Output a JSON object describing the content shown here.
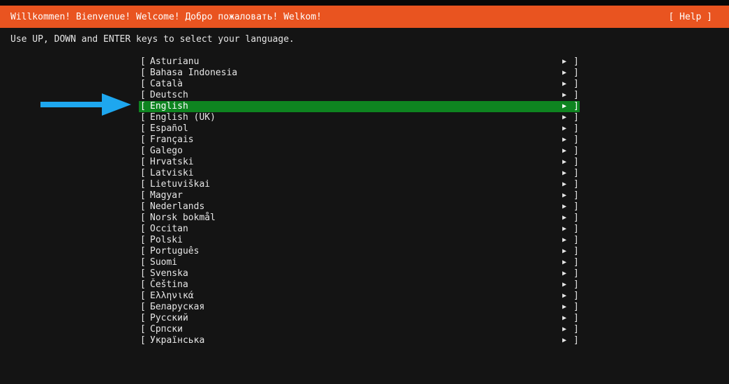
{
  "header": {
    "title": "Willkommen! Bienvenue! Welcome! Добро пожаловать! Welkom!",
    "help_label": "[ Help ]"
  },
  "instruction": "Use UP, DOWN and ENTER keys to select your language.",
  "languages": [
    {
      "label": "Asturianu"
    },
    {
      "label": "Bahasa Indonesia"
    },
    {
      "label": "Català"
    },
    {
      "label": "Deutsch"
    },
    {
      "label": "English",
      "selected": true
    },
    {
      "label": "English (UK)"
    },
    {
      "label": "Español"
    },
    {
      "label": "Français"
    },
    {
      "label": "Galego"
    },
    {
      "label": "Hrvatski"
    },
    {
      "label": "Latviski"
    },
    {
      "label": "Lietuviškai"
    },
    {
      "label": "Magyar"
    },
    {
      "label": "Nederlands"
    },
    {
      "label": "Norsk bokmål"
    },
    {
      "label": "Occitan"
    },
    {
      "label": "Polski"
    },
    {
      "label": "Português"
    },
    {
      "label": "Suomi"
    },
    {
      "label": "Svenska"
    },
    {
      "label": "Čeština"
    },
    {
      "label": "Ελληνικά"
    },
    {
      "label": "Беларуская"
    },
    {
      "label": "Русский"
    },
    {
      "label": "Српски"
    },
    {
      "label": "Українська"
    }
  ],
  "item_brackets": {
    "open": "[",
    "close": "]",
    "arrow": "▶"
  },
  "colors": {
    "header_bg": "#e95420",
    "selected_bg": "#0e8420",
    "pointer_arrow": "#1ea7ef",
    "background": "#141414"
  },
  "icons": {
    "pointer": "blue-right-arrow-icon",
    "submenu": "right-triangle-icon"
  }
}
